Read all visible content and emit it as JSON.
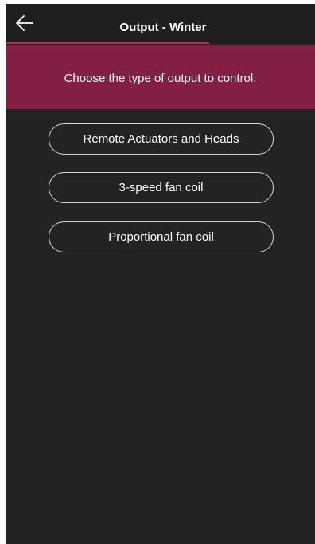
{
  "header": {
    "title": "Output - Winter",
    "back_icon": "arrow-left-icon",
    "accent_color": "#c8234f"
  },
  "banner": {
    "text": "Choose the type of output to control.",
    "background": "#831f42"
  },
  "options": [
    {
      "label": "Remote Actuators and Heads"
    },
    {
      "label": "3-speed fan coil"
    },
    {
      "label": "Proportional fan coil"
    }
  ],
  "colors": {
    "background": "#232323",
    "header_background": "#1f1f1f",
    "text": "#ffffff",
    "button_border": "#d6d6d6"
  }
}
